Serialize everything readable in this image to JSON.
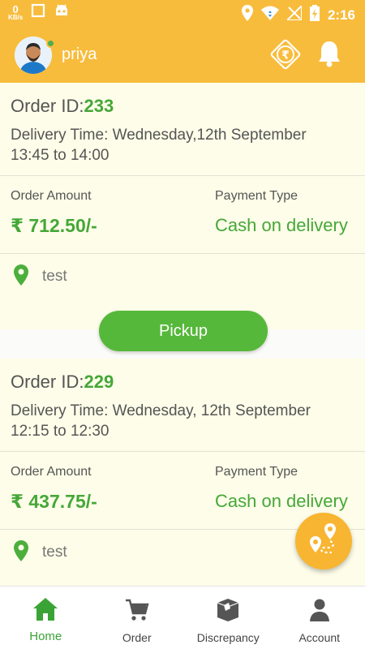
{
  "status_bar": {
    "net_speed": "0",
    "net_unit": "KB/s",
    "time": "2:16"
  },
  "header": {
    "user_name": "priya"
  },
  "orders": [
    {
      "id_label": "Order ID:",
      "id": "233",
      "delivery_line1": "Delivery Time: Wednesday,12th September",
      "delivery_line2": "13:45 to 14:00",
      "amount_label": "Order Amount",
      "amount": "₹ 712.50/-",
      "payment_label": "Payment Type",
      "payment": "Cash on delivery",
      "address": "test",
      "action": "Pickup"
    },
    {
      "id_label": "Order ID:",
      "id": "229",
      "delivery_line1": "Delivery Time: Wednesday, 12th September",
      "delivery_line2": "12:15 to 12:30",
      "amount_label": "Order Amount",
      "amount": "₹ 437.75/-",
      "payment_label": "Payment Type",
      "payment": "Cash on delivery",
      "address": "test"
    }
  ],
  "nav": {
    "items": [
      {
        "label": "Home",
        "icon": "home-icon",
        "active": true
      },
      {
        "label": "Order",
        "icon": "cart-icon",
        "active": false
      },
      {
        "label": "Discrepancy",
        "icon": "box-icon",
        "active": false
      },
      {
        "label": "Account",
        "icon": "person-icon",
        "active": false
      }
    ]
  },
  "colors": {
    "brand": "#f8bc3c",
    "accent_green": "#46a738",
    "card_bg": "#fdfde9"
  }
}
